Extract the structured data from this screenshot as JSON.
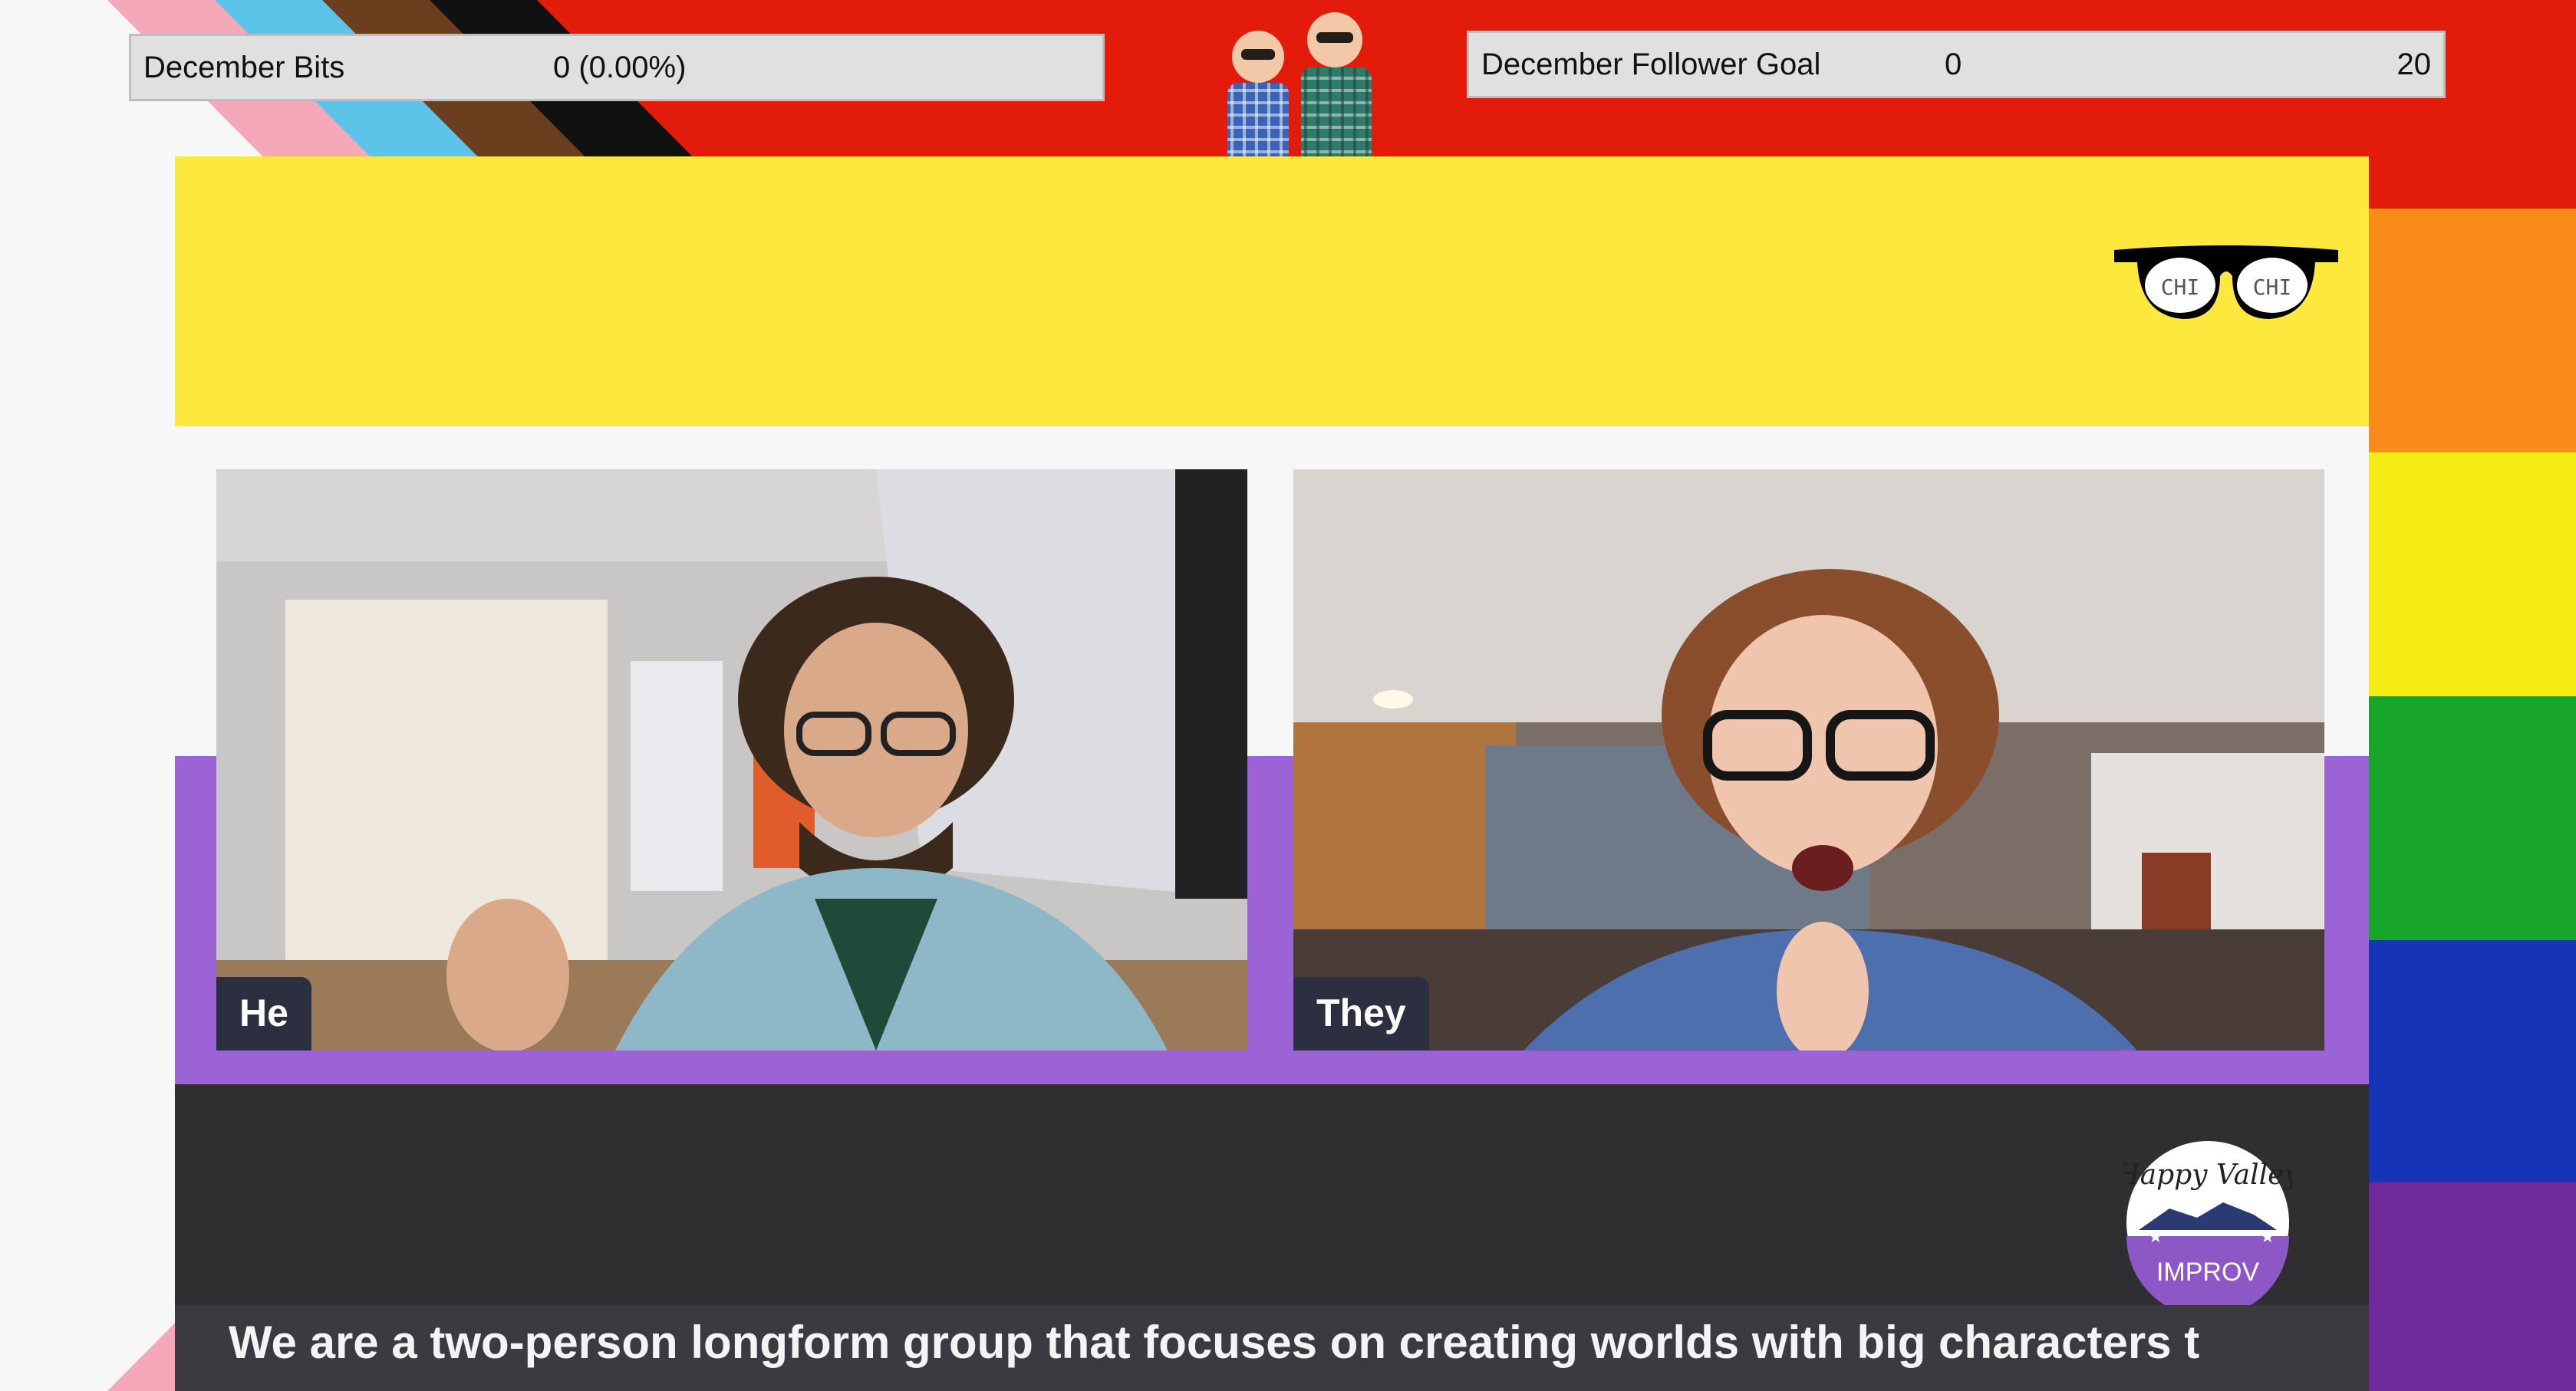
{
  "overlay": {
    "bits_goal": {
      "label": "December Bits",
      "value": "0 (0.00%)",
      "progress": 0
    },
    "follower_goal": {
      "label": "December Follower Goal",
      "current": "0",
      "target": "20",
      "progress": 0
    },
    "cams": [
      {
        "label": "He"
      },
      {
        "label": "They"
      }
    ],
    "ticker_text": "We are a two-person longform group that focuses on creating worlds with big characters t",
    "logo_text": {
      "top": "Happy Valley",
      "bottom": "IMPROV"
    },
    "glasses_text": [
      "CHI",
      "CHI"
    ]
  },
  "colors": {
    "yellow": "#fde83e",
    "white": "#f7f7f7",
    "purple": "#9b63d6",
    "dark": "#2f2f31",
    "rainbow": [
      "#e31b0a",
      "#f98b1a",
      "#f4ec12",
      "#17a52a",
      "#1634b8",
      "#6f2a9a"
    ]
  }
}
